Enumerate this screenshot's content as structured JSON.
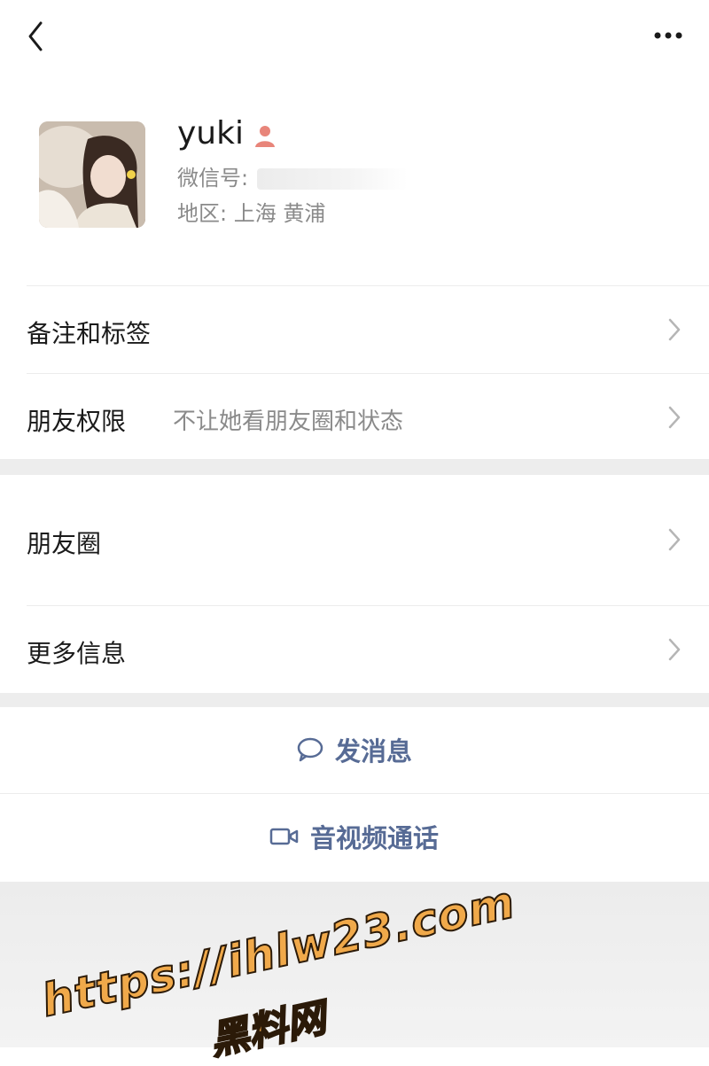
{
  "header": {
    "back_icon": "chevron-left-icon",
    "more_icon": "more-dots-icon"
  },
  "profile": {
    "name": "yuki",
    "gender_icon": "female-person-icon",
    "gender_color": "#e8857a",
    "wechat_id_label": "微信号:",
    "region": "地区: 上海 黄浦"
  },
  "rows": {
    "remarks": {
      "label": "备注和标签"
    },
    "permissions": {
      "label": "朋友权限",
      "value": "不让她看朋友圈和状态"
    },
    "moments": {
      "label": "朋友圈"
    },
    "more_info": {
      "label": "更多信息"
    }
  },
  "actions": {
    "message": {
      "label": "发消息",
      "icon": "chat-bubble-icon"
    },
    "video_call": {
      "label": "音视频通话",
      "icon": "video-camera-icon"
    }
  },
  "colors": {
    "link_blue": "#576b95",
    "watermark_orange": "#f0a94a"
  },
  "watermark": {
    "url": "https://ihlw23.com",
    "text": "黑料网"
  }
}
